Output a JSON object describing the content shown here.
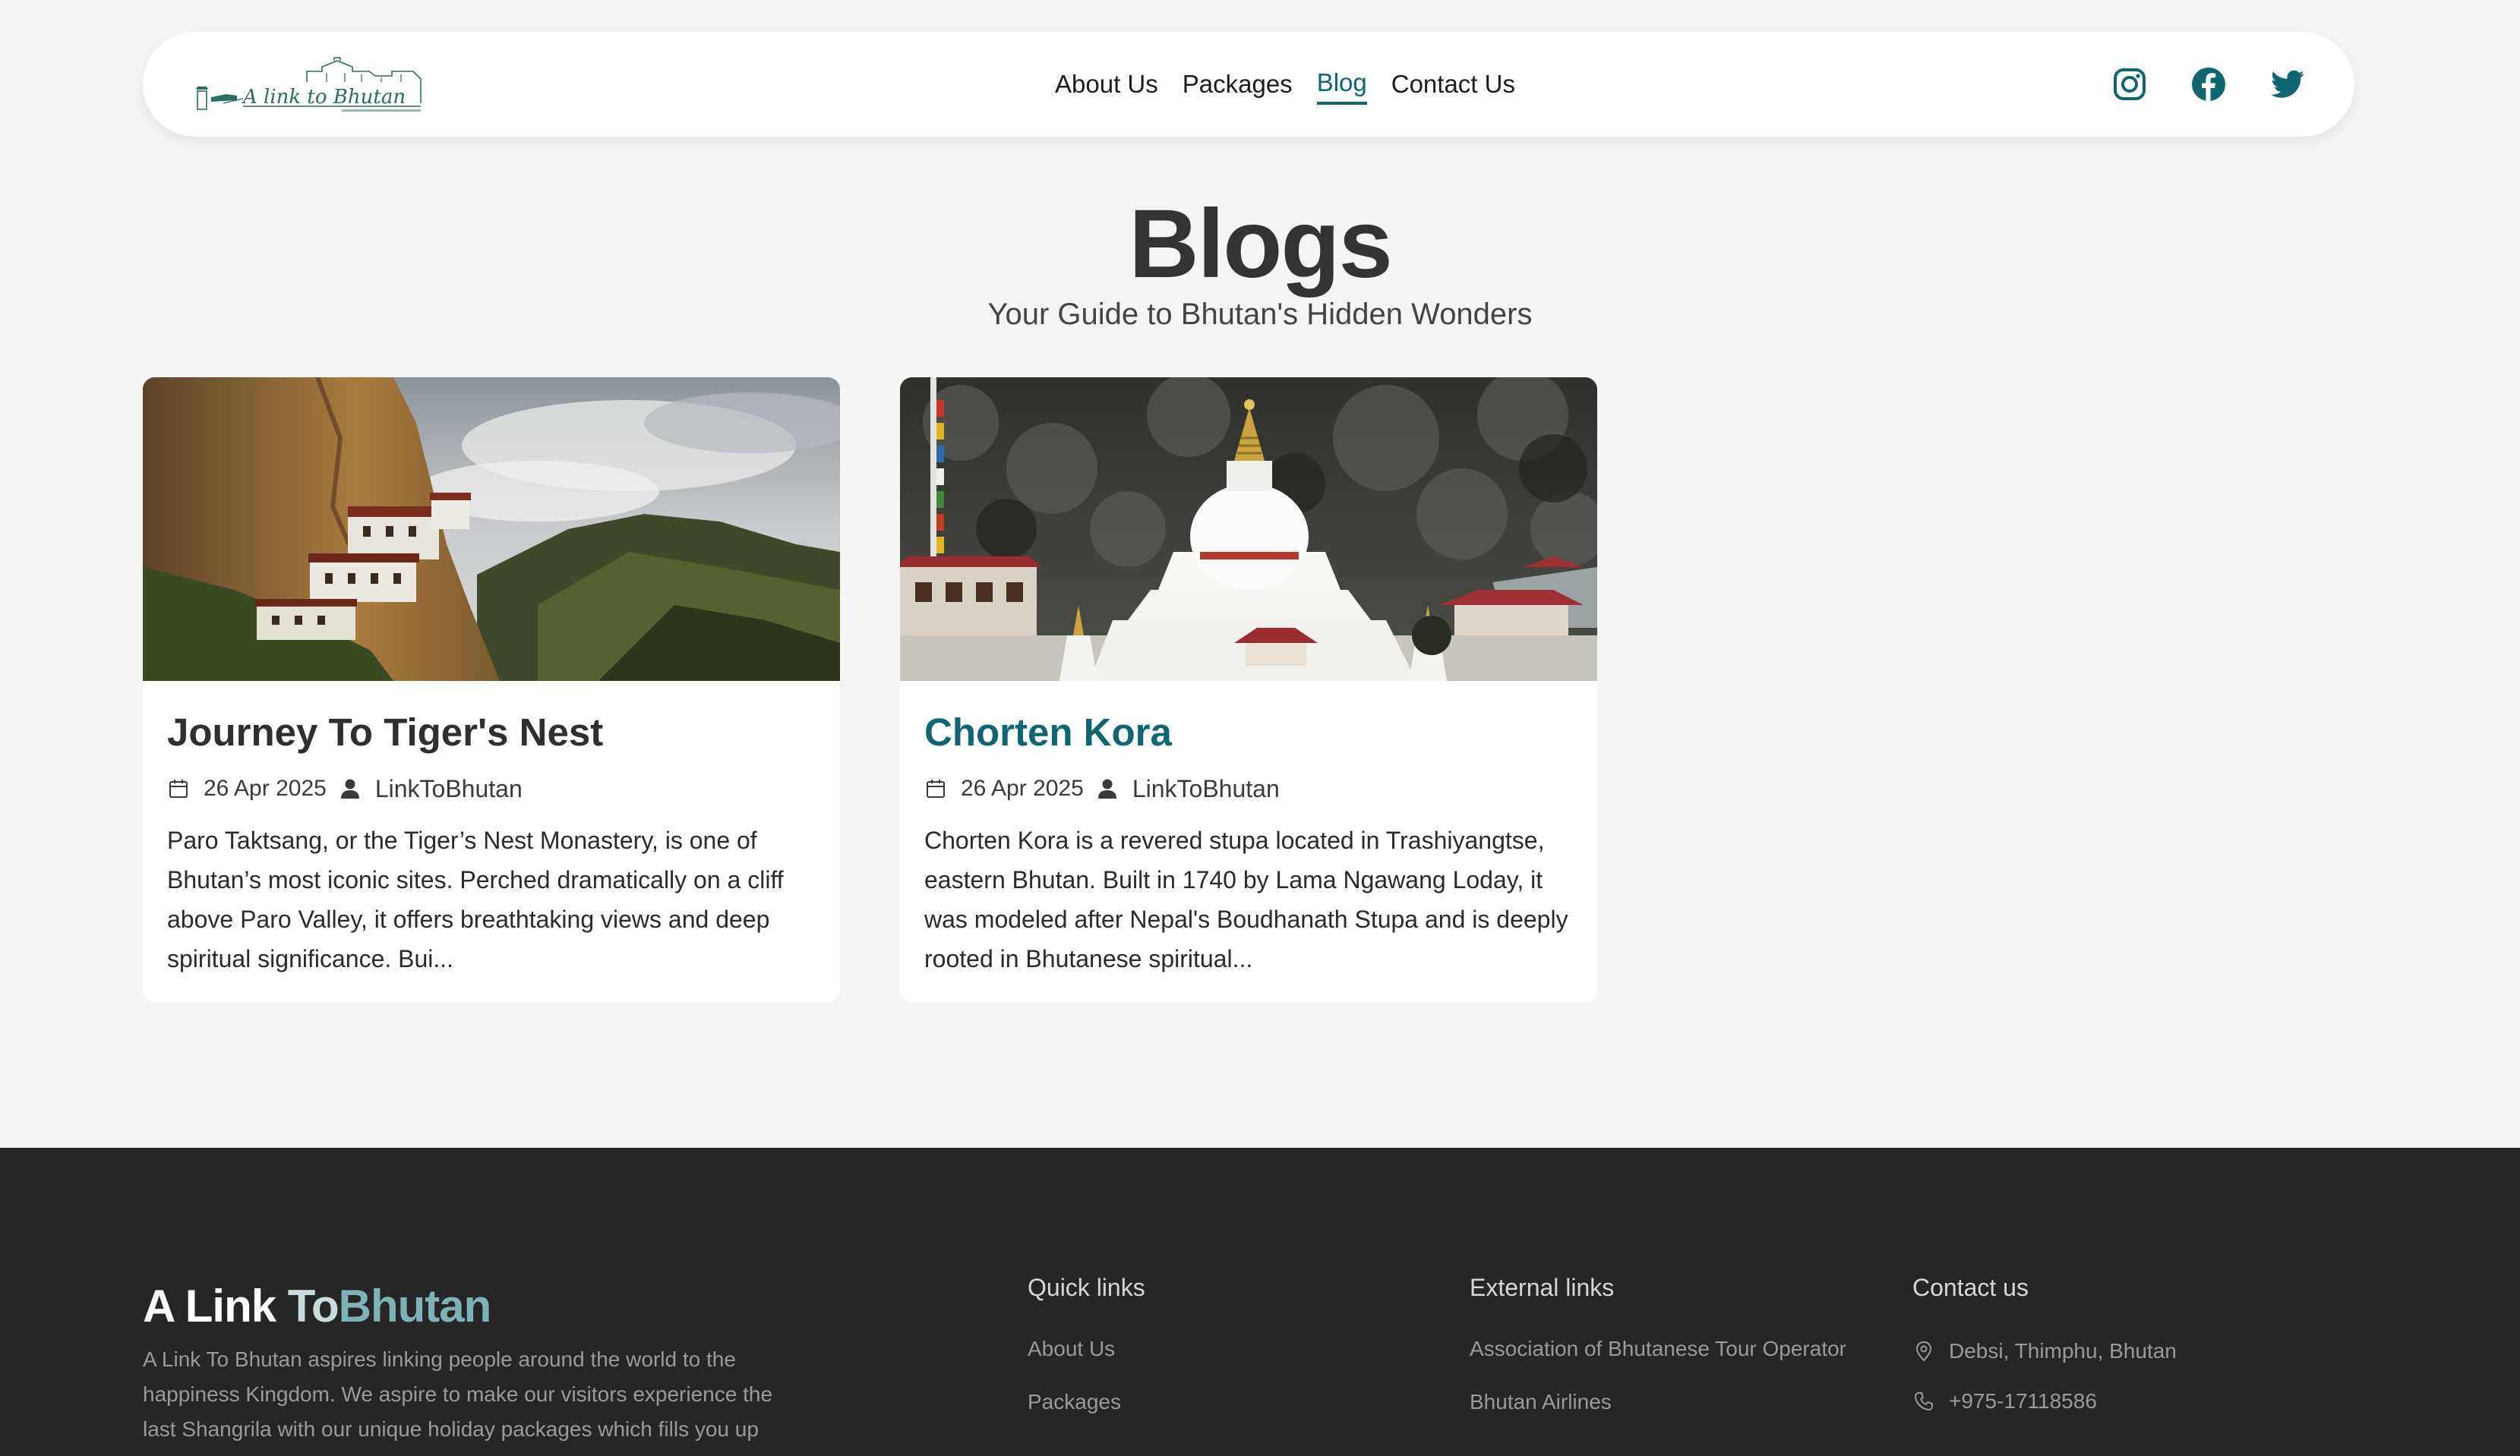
{
  "nav": {
    "logo_text": "A link to Bhutan",
    "links": [
      {
        "label": "About Us"
      },
      {
        "label": "Packages"
      },
      {
        "label": "Blog",
        "active": true
      },
      {
        "label": "Contact Us"
      }
    ],
    "socials": [
      "instagram-icon",
      "facebook-icon",
      "twitter-icon"
    ]
  },
  "header": {
    "title": "Blogs",
    "subtitle": "Your Guide to Bhutan's Hidden Wonders"
  },
  "blogs": [
    {
      "title": "Journey To Tiger's Nest",
      "date": "26 Apr 2025",
      "author": "LinkToBhutan",
      "excerpt": "Paro Taktsang, or the Tiger’s Nest Monastery, is one of Bhutan’s most iconic sites. Perched dramatically on a cliff above Paro Valley, it offers breathtaking views and deep spiritual significance. Bui..."
    },
    {
      "title": "Chorten Kora",
      "date": "26 Apr 2025",
      "author": "LinkToBhutan",
      "excerpt": "Chorten Kora is a revered stupa located in Trashiyangtse, eastern Bhutan. Built in 1740 by Lama Ngawang Loday, it was modeled after Nepal's Boudhanath Stupa and is deeply rooted in Bhutanese spiritual..."
    }
  ],
  "footer": {
    "brand_a": "A Link",
    "brand_to": "To",
    "brand_bhutan": "Bhutan",
    "about": "A Link To Bhutan aspires linking people around the world to the happiness Kingdom. We aspire to make our visitors experience the last Shangrila with our unique holiday packages which fills you up",
    "quick_links": {
      "heading": "Quick links",
      "items": [
        "About Us",
        "Packages"
      ]
    },
    "external_links": {
      "heading": "External links",
      "items": [
        "Association of Bhutanese Tour Operator",
        "Bhutan Airlines"
      ]
    },
    "contact": {
      "heading": "Contact us",
      "address": "Debsi, Thimphu, Bhutan",
      "phone": "+975-17118586"
    }
  },
  "colors": {
    "accent": "#0f6670",
    "background": "#f6f5f3",
    "footer_bg": "#262626"
  }
}
